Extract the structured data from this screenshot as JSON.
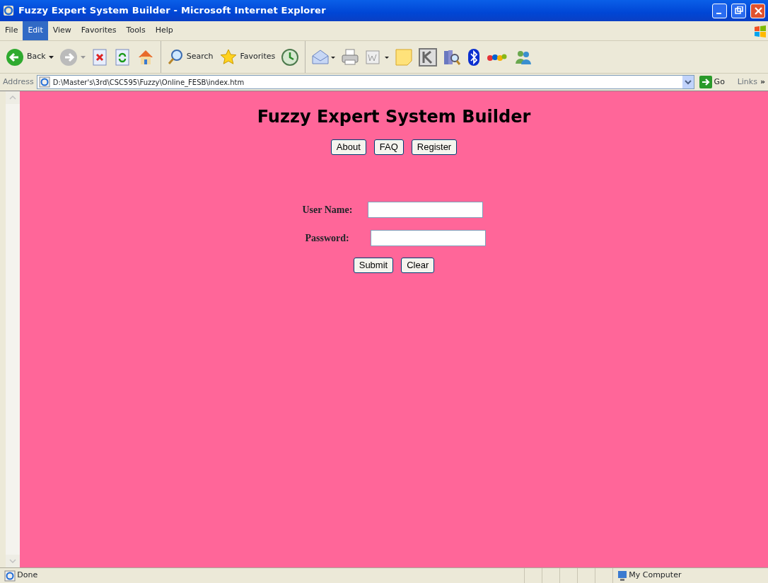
{
  "window": {
    "title": "Fuzzy Expert System Builder - Microsoft Internet Explorer"
  },
  "menu": [
    {
      "label": "File",
      "selected": false
    },
    {
      "label": "Edit",
      "selected": true
    },
    {
      "label": "View",
      "selected": false
    },
    {
      "label": "Favorites",
      "selected": false
    },
    {
      "label": "Tools",
      "selected": false
    },
    {
      "label": "Help",
      "selected": false
    }
  ],
  "toolbar": [
    {
      "kind": "back",
      "label": "Back"
    },
    {
      "kind": "forward"
    },
    {
      "kind": "stop"
    },
    {
      "kind": "refresh"
    },
    {
      "kind": "home"
    },
    {
      "kind": "search",
      "label": "Search"
    },
    {
      "kind": "favorites",
      "label": "Favorites"
    },
    {
      "kind": "history"
    },
    {
      "kind": "mail"
    },
    {
      "kind": "print"
    },
    {
      "kind": "edit"
    },
    {
      "kind": "note"
    },
    {
      "kind": "k"
    },
    {
      "kind": "books"
    },
    {
      "kind": "bluetooth"
    },
    {
      "kind": "ebay"
    },
    {
      "kind": "messenger"
    }
  ],
  "address": {
    "label": "Address",
    "value": "D:\\Master's\\3rd\\CSC595\\Fuzzy\\Online_FESB\\index.htm",
    "go": "Go",
    "links": "Links",
    "more": "»"
  },
  "page": {
    "heading": "Fuzzy Expert System Builder",
    "nav": [
      "About",
      "FAQ",
      "Register"
    ],
    "fields": [
      {
        "label": "User Name:"
      },
      {
        "label": "Password:"
      }
    ],
    "buttons": [
      "Submit",
      "Clear"
    ]
  },
  "status_bar": {
    "text": "Done",
    "zone": "My Computer"
  }
}
